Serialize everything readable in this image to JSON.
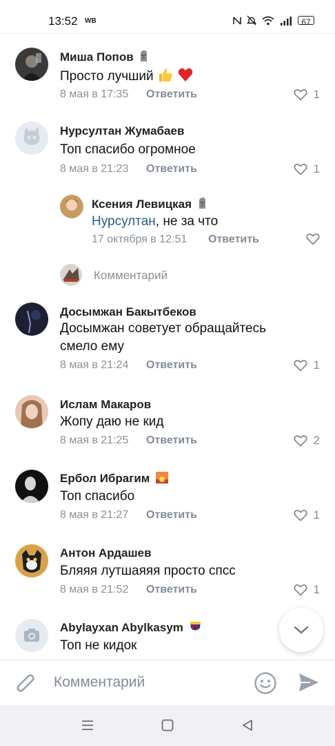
{
  "status_bar": {
    "time": "13:52",
    "carrier_badge": "WB",
    "battery": "67",
    "icons": [
      "nfc-icon",
      "mute-icon",
      "wifi-icon",
      "signal-icon",
      "battery-icon"
    ]
  },
  "comments": [
    {
      "author": "Миша Попов",
      "badge": "moai",
      "text": "Просто лучший",
      "emojis": [
        "thumbs-up",
        "red-heart"
      ],
      "date": "8 мая в 17:35",
      "reply_label": "Ответить",
      "likes": "1"
    },
    {
      "author": "Нурсултан Жумабаев",
      "text": "Топ спасибо огромное",
      "date": "8 мая в 21:23",
      "reply_label": "Ответить",
      "likes": "1"
    },
    {
      "author": "Досымжан Бакытбеков",
      "text_line1": "Досымжан советует обращайтесь",
      "text_line2": "смело ему",
      "date": "8 мая в 21:24",
      "reply_label": "Ответить",
      "likes": "1"
    },
    {
      "author": "Ислам Макаров",
      "text": "Жопу даю не кид",
      "date": "8 мая в 21:25",
      "reply_label": "Ответить",
      "likes": "2"
    },
    {
      "author": "Ербол Ибрагим",
      "badge": "sunrise",
      "text": "Топ спасибо",
      "date": "8 мая в 21:27",
      "reply_label": "Ответить",
      "likes": "1"
    },
    {
      "author": "Антон Ардашев",
      "text": "Бляяя лутшаяяя просто спсс",
      "date": "8 мая в 21:52",
      "reply_label": "Ответить",
      "likes": "1"
    },
    {
      "author": "Abylayxan Abylkasym",
      "badge": "barcelona",
      "text": "Топ не кидок"
    }
  ],
  "reply": {
    "author": "Ксения Левицкая",
    "badge": "moai",
    "mention": "Нурсултан",
    "text": ", не за что",
    "date": "17 октября в 12:51",
    "reply_label": "Ответить"
  },
  "reply_input": {
    "placeholder": "Комментарий"
  },
  "input_bar": {
    "placeholder": "Комментарий"
  },
  "colors": {
    "accent": "#2a5885",
    "secondary_text": "#828b95",
    "heart_red": "#e64646"
  }
}
